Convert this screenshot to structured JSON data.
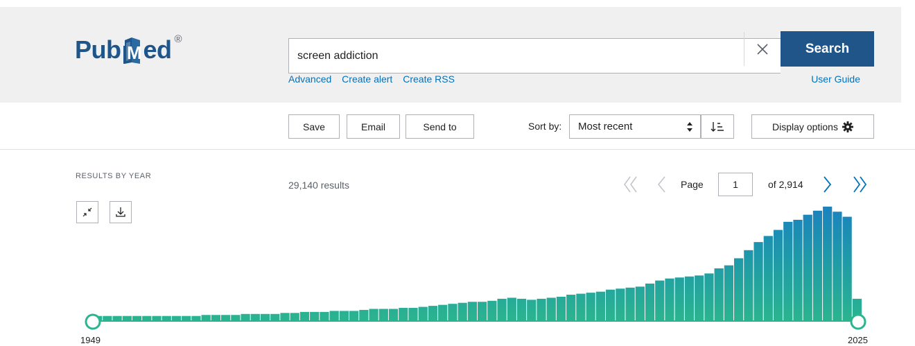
{
  "header": {
    "logo": {
      "text_left": "Pub",
      "text_right": "ed",
      "registered": "®"
    },
    "search": {
      "value": "screen addiction",
      "button_label": "Search",
      "clear_icon": "close-icon"
    },
    "links": [
      "Advanced",
      "Create alert",
      "Create RSS"
    ],
    "user_guide": "User Guide"
  },
  "toolbar": {
    "save_label": "Save",
    "email_label": "Email",
    "send_to_label": "Send to",
    "sort_by_label": "Sort by:",
    "sort_value": "Most recent",
    "display_options_label": "Display options",
    "icons": {
      "sort_order": "sort-order-icon",
      "display_options": "gear-icon"
    }
  },
  "results": {
    "by_year_label": "RESULTS BY YEAR",
    "count_label": "29,140 results",
    "icons": {
      "collapse": "collapse-icon",
      "download": "download-icon"
    }
  },
  "pagination": {
    "page_label": "Page",
    "current_page": "1",
    "of_label": "of 2,914"
  },
  "chart_data": {
    "type": "bar",
    "title": "",
    "xlabel": "",
    "ylabel": "",
    "x_range": [
      1949,
      2025
    ],
    "tick_labels": [
      "1949",
      "2025"
    ],
    "years": [
      1949,
      1950,
      1951,
      1952,
      1953,
      1954,
      1955,
      1956,
      1957,
      1958,
      1959,
      1960,
      1961,
      1962,
      1963,
      1964,
      1965,
      1966,
      1967,
      1968,
      1969,
      1970,
      1971,
      1972,
      1973,
      1974,
      1975,
      1976,
      1977,
      1978,
      1979,
      1980,
      1981,
      1982,
      1983,
      1984,
      1985,
      1986,
      1987,
      1988,
      1989,
      1990,
      1991,
      1992,
      1993,
      1994,
      1995,
      1996,
      1997,
      1998,
      1999,
      2000,
      2001,
      2002,
      2003,
      2004,
      2005,
      2006,
      2007,
      2008,
      2009,
      2010,
      2011,
      2012,
      2013,
      2014,
      2015,
      2016,
      2017,
      2018,
      2019,
      2020,
      2021,
      2022,
      2023,
      2024,
      2025
    ],
    "values": [
      5,
      5,
      5,
      5,
      5,
      5,
      5,
      5,
      5,
      5,
      5,
      6,
      6,
      6,
      6,
      7,
      7,
      7,
      7,
      8,
      8,
      9,
      9,
      9,
      10,
      10,
      10,
      11,
      12,
      12,
      12,
      13,
      13,
      14,
      15,
      16,
      17,
      18,
      19,
      19,
      20,
      22,
      23,
      22,
      21,
      22,
      23,
      24,
      26,
      27,
      28,
      29,
      31,
      32,
      33,
      34,
      37,
      40,
      42,
      43,
      44,
      45,
      47,
      52,
      55,
      62,
      70,
      78,
      84,
      90,
      98,
      100,
      105,
      109,
      113,
      108,
      103,
      22
    ],
    "colors": {
      "low": "#2bb48f",
      "high": "#1a7ec2",
      "axis": "#2bb48f"
    }
  }
}
